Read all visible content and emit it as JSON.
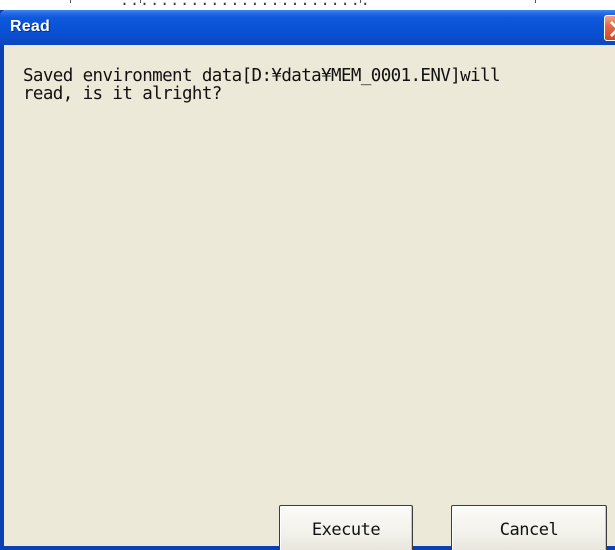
{
  "window": {
    "title": "Read",
    "close_icon": "close-icon"
  },
  "message": {
    "text": "Saved environment data[D:¥data¥MEM_0001.ENV]will\nread, is it alright?"
  },
  "buttons": {
    "execute_label": "Execute",
    "cancel_label": "Cancel"
  },
  "colors": {
    "titlebar": "#0a4ccb",
    "dialog_bg": "#ece9d8",
    "close_button": "#d2462a",
    "title_text": "#ffffff"
  }
}
